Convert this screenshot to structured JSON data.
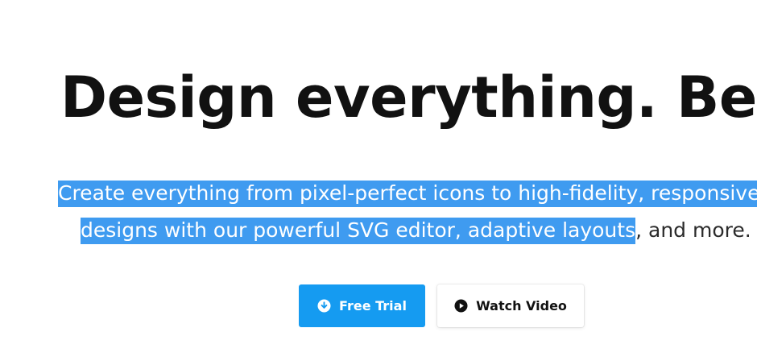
{
  "hero": {
    "headline": "Design everything. Better.",
    "subtitle": {
      "line1_selected": "Create everything from pixel-perfect icons to high-fidelity, responsive",
      "line2_selected": "designs with our powerful SVG editor, adaptive layouts",
      "line2_rest": ", and more."
    },
    "buttons": {
      "free_trial": {
        "label": "Free Trial",
        "icon": "download-circle-icon",
        "color": "#159bf1"
      },
      "watch_video": {
        "label": "Watch Video",
        "icon": "play-circle-icon"
      }
    },
    "selection_color": "#3f9bf0"
  }
}
